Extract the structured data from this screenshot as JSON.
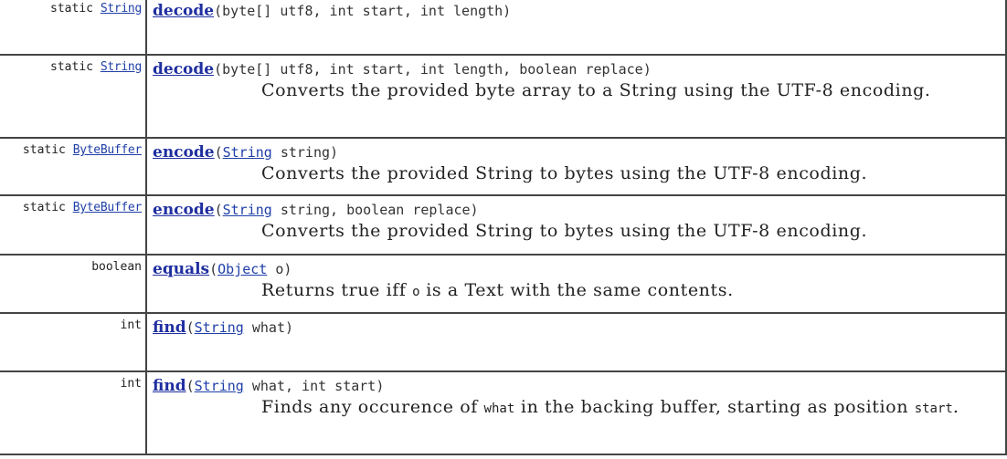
{
  "rows": [
    {
      "modifier": "static ",
      "return_type": "String",
      "method": "decode",
      "params_before": "(byte[] utf8, int start, int length)",
      "description": ""
    },
    {
      "modifier": "static ",
      "return_type": "String",
      "method": "decode",
      "params_before": "(byte[] utf8, int start, int length, boolean replace)",
      "description": "Converts the provided byte array to a String using the UTF-8 encoding."
    },
    {
      "modifier": "static ",
      "return_type": "ByteBuffer",
      "method": "encode",
      "param_type": "String",
      "params_after": " string)",
      "description": "Converts the provided String to bytes using the UTF-8 encoding."
    },
    {
      "modifier": "static ",
      "return_type": "ByteBuffer",
      "method": "encode",
      "param_type": "String",
      "params_after": " string, boolean replace)",
      "description": "Converts the provided String to bytes using the UTF-8 encoding."
    },
    {
      "modifier": "boolean",
      "method": "equals",
      "param_type": "Object",
      "params_after": " o)",
      "description_parts": [
        "Returns true iff ",
        "o",
        " is a Text with the same contents."
      ]
    },
    {
      "modifier": "int",
      "method": "find",
      "param_type": "String",
      "params_after": " what)",
      "description": ""
    },
    {
      "modifier": "int",
      "method": "find",
      "param_type": "String",
      "params_after": " what, int start)",
      "description_parts": [
        "Finds any occurence of ",
        "what",
        " in the backing buffer, starting as position ",
        "start",
        "."
      ]
    }
  ]
}
